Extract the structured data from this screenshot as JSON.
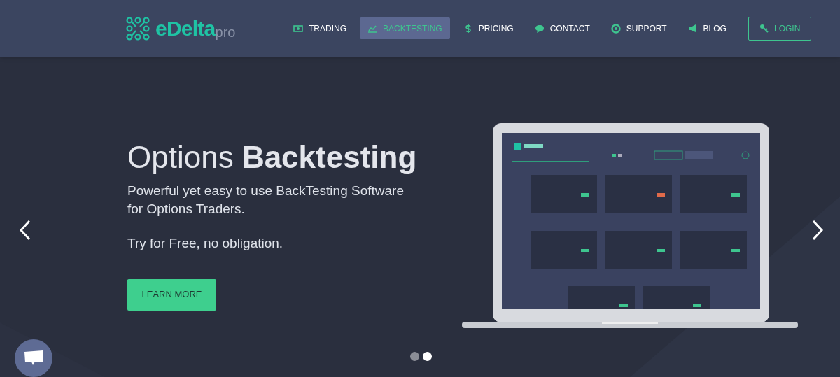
{
  "logo": {
    "brand": "eDelta",
    "suffix": "pro"
  },
  "nav": [
    {
      "label": "TRADING",
      "selected": false
    },
    {
      "label": "BACKTESTING",
      "selected": true
    },
    {
      "label": "PRICING",
      "selected": false
    },
    {
      "label": "CONTACT",
      "selected": false
    },
    {
      "label": "SUPPORT",
      "selected": false
    },
    {
      "label": "BLOG",
      "selected": false
    }
  ],
  "login": {
    "label": "LOGIN"
  },
  "hero": {
    "title": "Options **Backtesting**",
    "subtitle": "Powerful yet easy to use BackTesting Software for Options Traders.",
    "note": "Try for Free, no obligation.",
    "button": "LEARN MORE"
  },
  "slides": [
    {
      "selected": false
    },
    {
      "selected": true
    }
  ]
}
